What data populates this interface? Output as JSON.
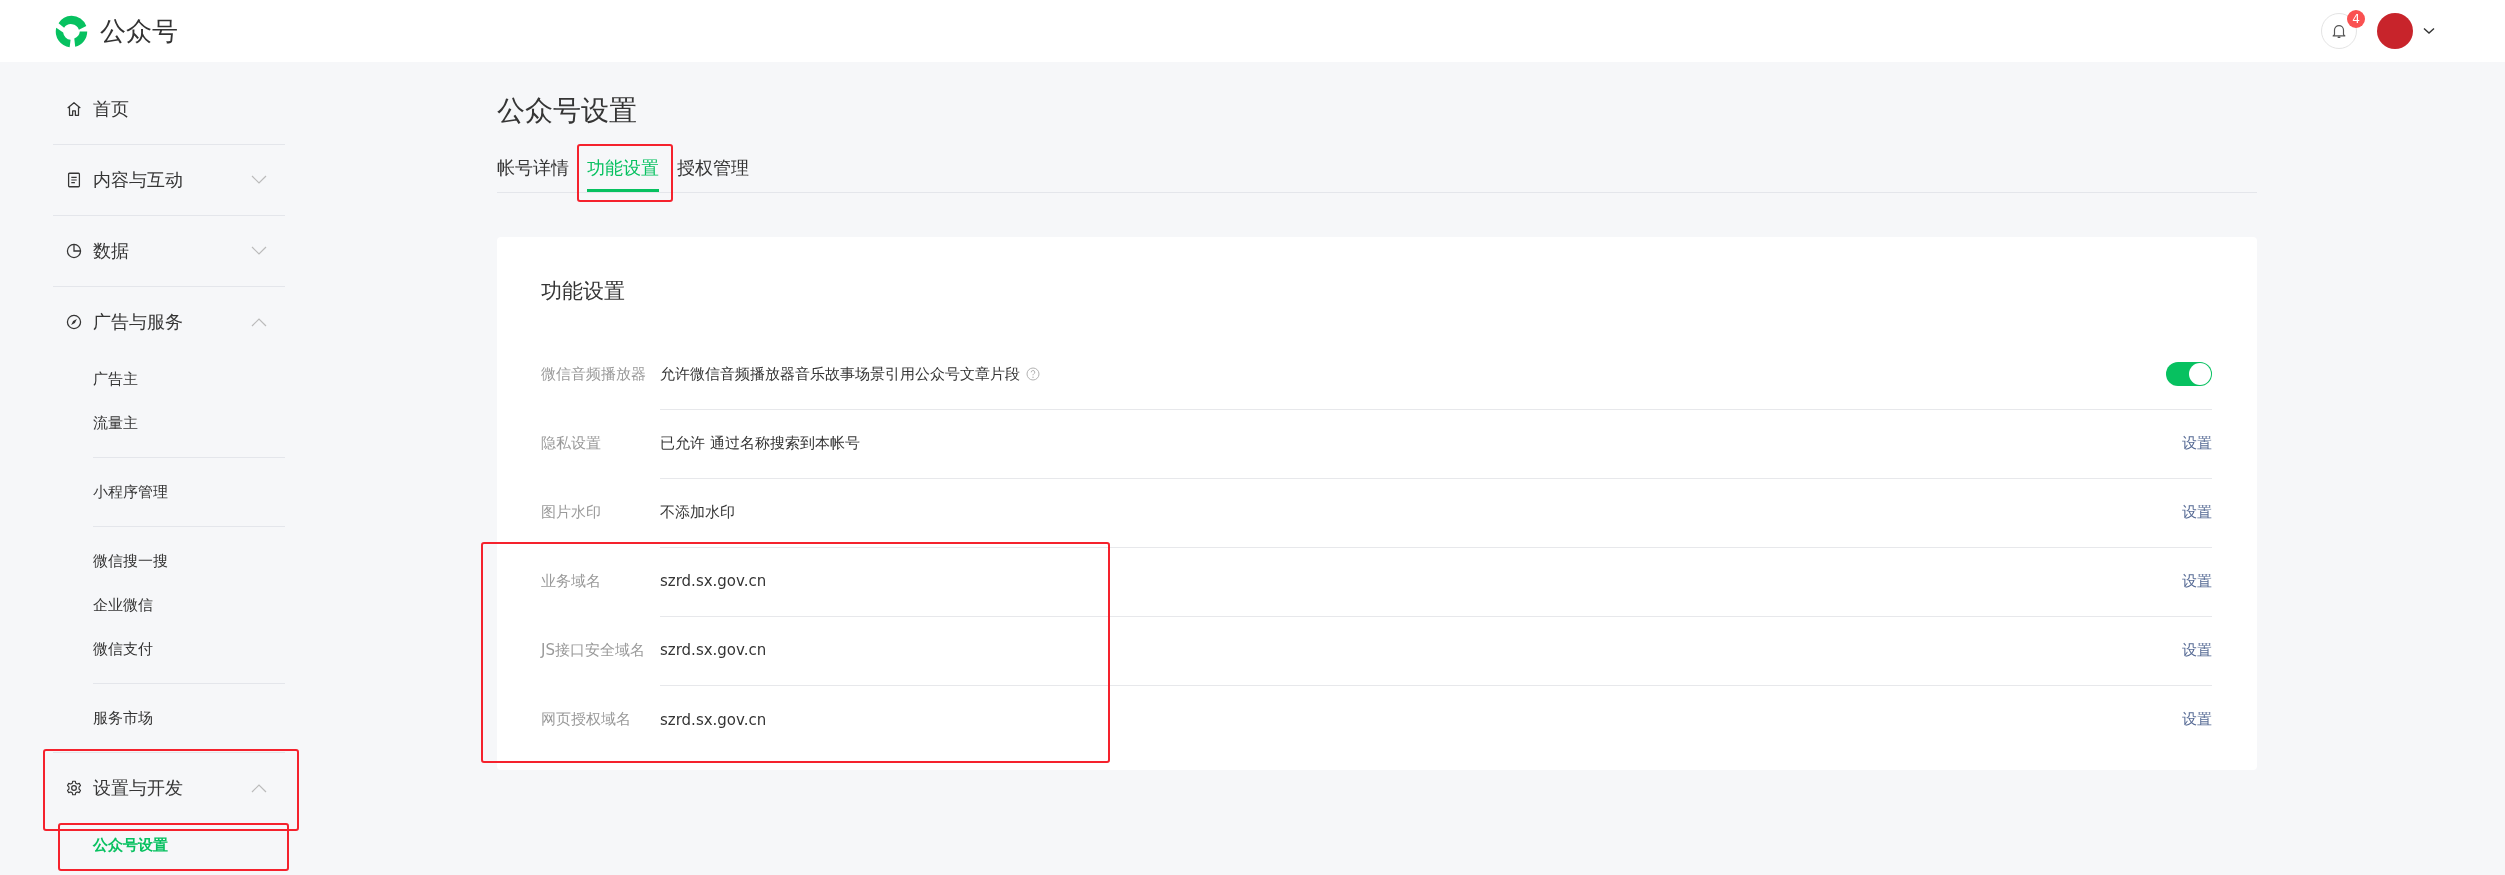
{
  "header": {
    "logo_text": "公众号",
    "notifications": {
      "count": "4"
    }
  },
  "sidebar": {
    "items": [
      {
        "label": "首页",
        "kind": "home"
      },
      {
        "label": "内容与互动",
        "kind": "document",
        "expanded": false
      },
      {
        "label": "数据",
        "kind": "chart",
        "expanded": false
      },
      {
        "label": "广告与服务",
        "kind": "compass",
        "expanded": true,
        "groups": [
          {
            "items": [
              {
                "label": "广告主",
                "selected": false
              },
              {
                "label": "流量主",
                "selected": false
              }
            ]
          },
          {
            "items": [
              {
                "label": "小程序管理",
                "selected": false
              }
            ]
          },
          {
            "items": [
              {
                "label": "微信搜一搜",
                "selected": false
              },
              {
                "label": "企业微信",
                "selected": false
              },
              {
                "label": "微信支付",
                "selected": false
              }
            ]
          },
          {
            "items": [
              {
                "label": "服务市场",
                "selected": false
              }
            ]
          }
        ]
      },
      {
        "label": "设置与开发",
        "kind": "gear",
        "expanded": true,
        "highlighted": true,
        "groups": [
          {
            "items": [
              {
                "label": "公众号设置",
                "selected": true,
                "highlighted": true
              }
            ]
          }
        ]
      }
    ]
  },
  "page": {
    "title": "公众号设置",
    "tabs": [
      {
        "label": "帐号详情",
        "selected": false,
        "highlighted": false
      },
      {
        "label": "功能设置",
        "selected": true,
        "highlighted": true
      },
      {
        "label": "授权管理",
        "selected": false,
        "highlighted": false
      }
    ],
    "card": {
      "title": "功能设置",
      "rows": [
        {
          "kind": "toggle",
          "label": "微信音频播放器",
          "value": "允许微信音频播放器音乐故事场景引用公众号文章片段",
          "help": true,
          "on": true,
          "highlighted": false
        },
        {
          "kind": "link",
          "label": "隐私设置",
          "value": "已允许 通过名称搜索到本帐号",
          "action": "设置",
          "highlighted": false
        },
        {
          "kind": "link",
          "label": "图片水印",
          "value": "不添加水印",
          "action": "设置",
          "highlighted": false
        },
        {
          "kind": "link",
          "label": "业务域名",
          "value": "szrd.sx.gov.cn",
          "action": "设置",
          "highlighted": true
        },
        {
          "kind": "link",
          "label": "JS接口安全域名",
          "value": "szrd.sx.gov.cn",
          "action": "设置",
          "highlighted": true
        },
        {
          "kind": "link",
          "label": "网页授权域名",
          "value": "szrd.sx.gov.cn",
          "action": "设置",
          "highlighted": true
        }
      ]
    }
  }
}
